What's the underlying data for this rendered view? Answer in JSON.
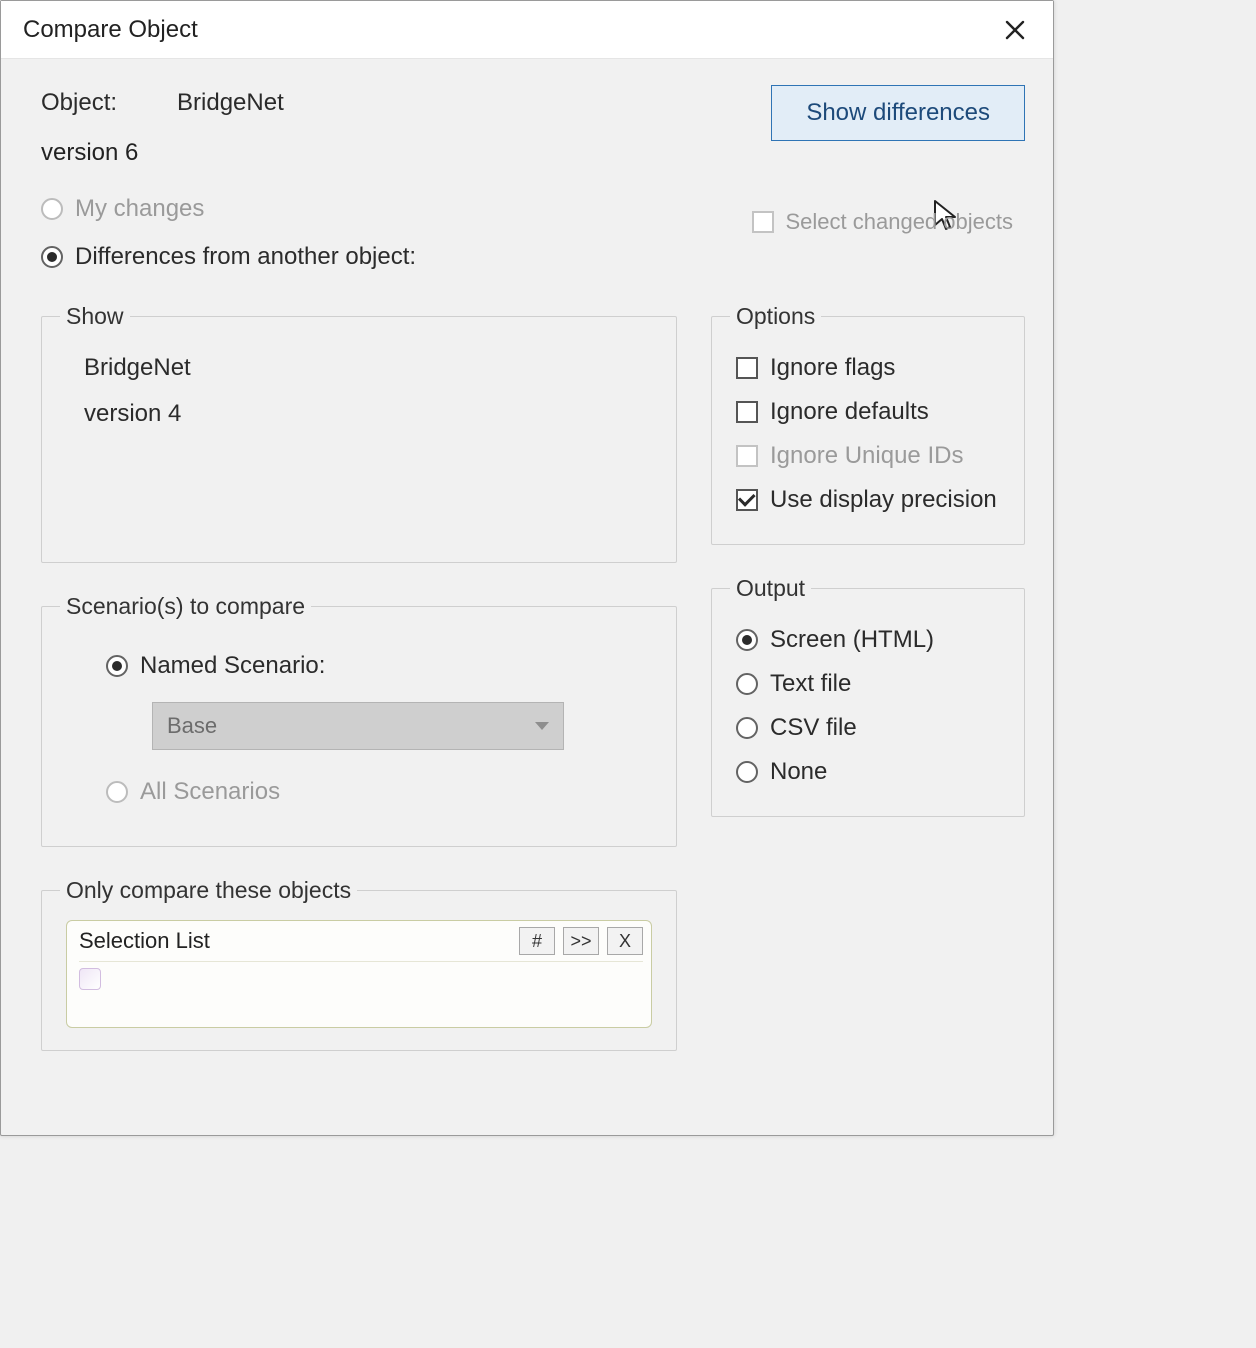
{
  "window": {
    "title": "Compare Object"
  },
  "object": {
    "label": "Object:",
    "name": "BridgeNet",
    "version": "version 6"
  },
  "actions": {
    "show_differences": "Show differences",
    "select_changed": "Select changed objects"
  },
  "source": {
    "my_changes": "My changes",
    "diff_from": "Differences from another object:"
  },
  "show_group": {
    "legend": "Show",
    "name": "BridgeNet",
    "version": "version 4"
  },
  "scenario": {
    "legend": "Scenario(s) to compare",
    "named": "Named Scenario:",
    "combo_value": "Base",
    "all": "All Scenarios"
  },
  "options": {
    "legend": "Options",
    "ignore_flags": "Ignore flags",
    "ignore_defaults": "Ignore defaults",
    "ignore_uids": "Ignore Unique IDs",
    "use_precision": "Use display precision"
  },
  "output": {
    "legend": "Output",
    "screen": "Screen (HTML)",
    "text": "Text file",
    "csv": "CSV file",
    "none": "None"
  },
  "only_group": {
    "legend": "Only compare these objects",
    "panel_title": "Selection List",
    "btn_num": "#",
    "btn_next": ">>",
    "btn_clear": "X"
  }
}
